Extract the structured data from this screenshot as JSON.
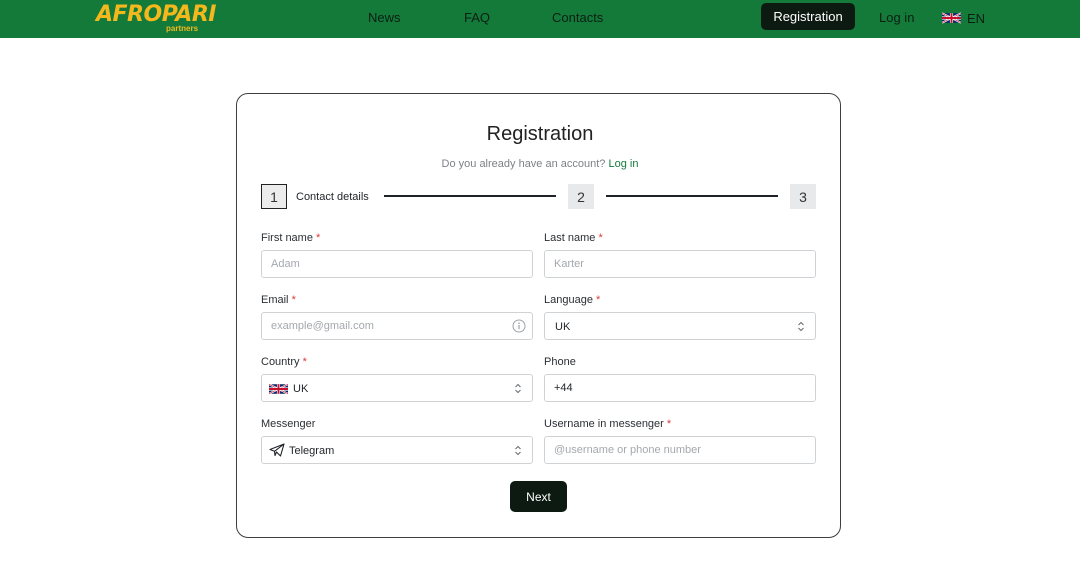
{
  "header": {
    "logo_text": "AFROPARI",
    "logo_sub": "partners",
    "nav": {
      "news": "News",
      "faq": "FAQ",
      "contacts": "Contacts"
    },
    "registration": "Registration",
    "login": "Log in",
    "language": "EN"
  },
  "card": {
    "title": "Registration",
    "subtitle": "Do you already have an account?",
    "login_link": "Log in"
  },
  "stepper": {
    "step1_number": "1",
    "step1_label": "Contact details",
    "step2_number": "2",
    "step3_number": "3"
  },
  "form": {
    "first_name": {
      "label": "First name",
      "required": "*",
      "placeholder": "Adam",
      "value": ""
    },
    "last_name": {
      "label": "Last name",
      "required": "*",
      "placeholder": "Karter",
      "value": ""
    },
    "email": {
      "label": "Email",
      "required": "*",
      "placeholder": "example@gmail.com",
      "value": ""
    },
    "language": {
      "label": "Language",
      "required": "*",
      "value": "UK"
    },
    "country": {
      "label": "Country",
      "required": "*",
      "value": "UK"
    },
    "phone": {
      "label": "Phone",
      "value": "+44"
    },
    "messenger": {
      "label": "Messenger",
      "value": "Telegram"
    },
    "username": {
      "label": "Username in messenger",
      "required": "*",
      "placeholder": "@username or phone number",
      "value": ""
    },
    "next_label": "Next"
  },
  "colors": {
    "header_bg": "#137a3a",
    "logo": "#f5b81c",
    "dark_button": "#0d1a12",
    "link": "#137a3a",
    "required": "#d93b3b"
  },
  "icons": {
    "lang_flag": "uk-flag-icon",
    "country_flag": "uk-flag-icon",
    "messenger": "paper-plane-icon",
    "email_info": "info-icon",
    "select": "chevron-updown-icon"
  }
}
